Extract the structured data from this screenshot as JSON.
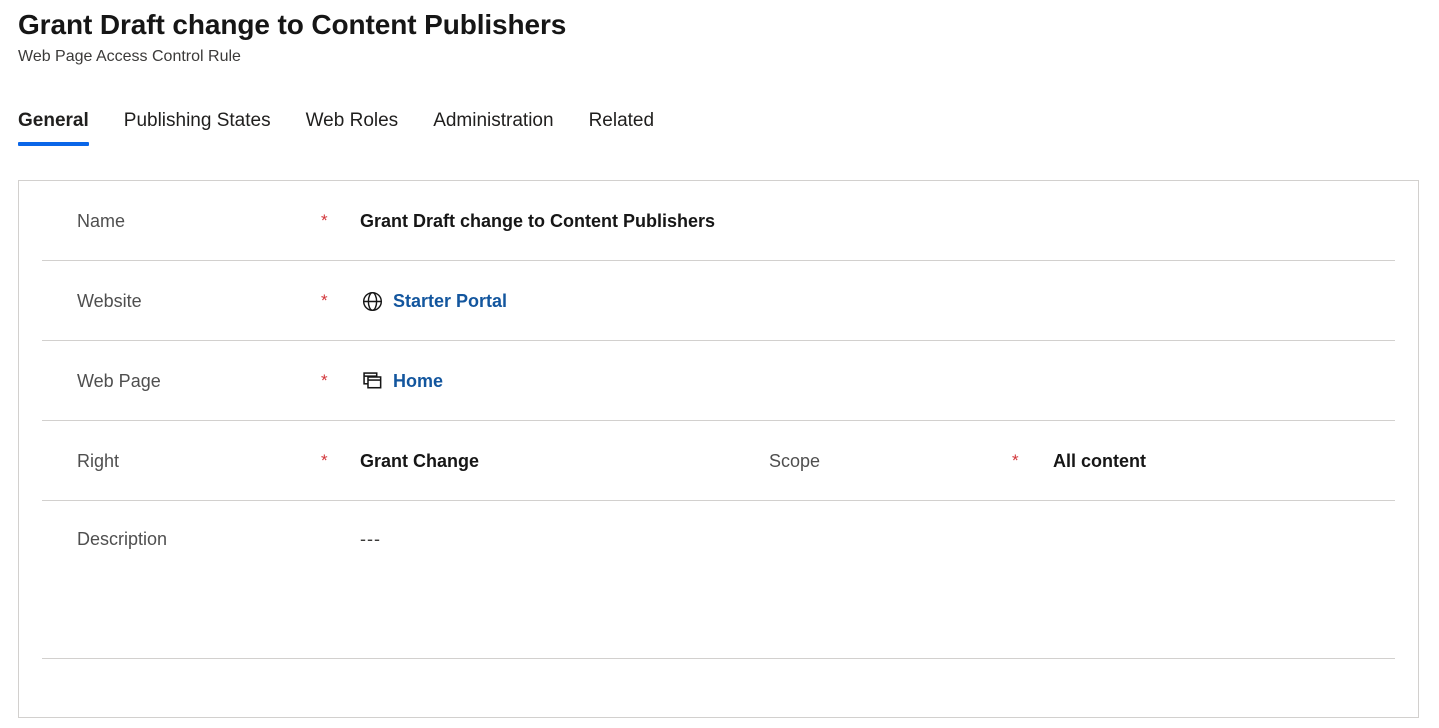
{
  "header": {
    "title": "Grant Draft change to Content Publishers",
    "subtitle": "Web Page Access Control Rule"
  },
  "colors": {
    "accent": "#0a66e8",
    "link": "#13569e",
    "required_asterisk": "#d13438",
    "label": "#4f4f4f",
    "border": "#d2d0ce"
  },
  "tabs": [
    {
      "label": "General",
      "active": true
    },
    {
      "label": "Publishing States",
      "active": false
    },
    {
      "label": "Web Roles",
      "active": false
    },
    {
      "label": "Administration",
      "active": false
    },
    {
      "label": "Related",
      "active": false
    }
  ],
  "form": {
    "required_marker": "*",
    "fields": {
      "name": {
        "label": "Name",
        "required": true,
        "value": "Grant Draft change to Content Publishers"
      },
      "website": {
        "label": "Website",
        "required": true,
        "value": "Starter Portal",
        "icon": "globe-icon",
        "is_link": true
      },
      "web_page": {
        "label": "Web Page",
        "required": true,
        "value": "Home",
        "icon": "stacked-pages-icon",
        "is_link": true
      },
      "right": {
        "label": "Right",
        "required": true,
        "value": "Grant Change"
      },
      "scope": {
        "label": "Scope",
        "required": true,
        "value": "All content"
      },
      "description": {
        "label": "Description",
        "required": false,
        "value": "---"
      }
    }
  }
}
